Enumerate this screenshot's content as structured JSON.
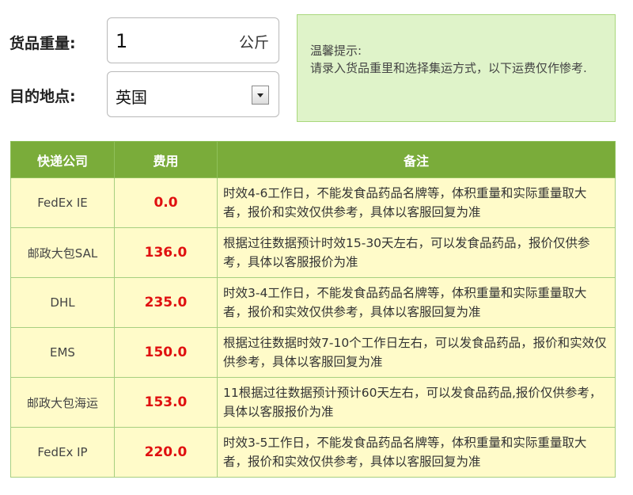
{
  "form": {
    "weight_label": "货品重量:",
    "weight_value": "1",
    "weight_unit": "公斤",
    "destination_label": "目的地点:",
    "destination_value": "英国"
  },
  "tip": {
    "title": "温馨提示:",
    "text": "请录入货品重里和选择集运方式，以下运费仅作惨考."
  },
  "table": {
    "headers": [
      "快递公司",
      "费用",
      "备注"
    ],
    "rows": [
      {
        "company": "FedEx IE",
        "fee": "0.0",
        "note": "时效4-6工作日，不能发食品药品名牌等，体积重量和实际重量取大者，报价和实效仅供参考，具体以客服回复为准"
      },
      {
        "company": "邮政大包SAL",
        "fee": "136.0",
        "note": "根据过往数据预计时效15-30天左右，可以发食品药品，报价仅供参考，具体以客服报价为准"
      },
      {
        "company": "DHL",
        "fee": "235.0",
        "note": "时效3-4工作日，不能发食品药品名牌等，体积重量和实际重量取大者，报价和实效仅供参考，具体以客服回复为准"
      },
      {
        "company": "EMS",
        "fee": "150.0",
        "note": "根据过往数据时效7-10个工作日左右，可以发食品药品，报价和实效仅供参考，具体以客服回复为准"
      },
      {
        "company": "邮政大包海运",
        "fee": "153.0",
        "note": "11根据过往数据预计预计60天左右，可以发食品药品,报价仅供参考，具体以客服报价为准"
      },
      {
        "company": "FedEx IP",
        "fee": "220.0",
        "note": "时效3-5工作日，不能发食品药品名牌等，体积重量和实际重量取大者，报价和实效仅供参考，具体以客服回复为准"
      }
    ]
  },
  "colors": {
    "header_bg": "#7aac3a",
    "row_bg": "#fffbc9",
    "tip_bg": "#dff3c9",
    "fee_text": "#e01010"
  },
  "icons": {
    "dropdown": "chevron-down-icon"
  }
}
